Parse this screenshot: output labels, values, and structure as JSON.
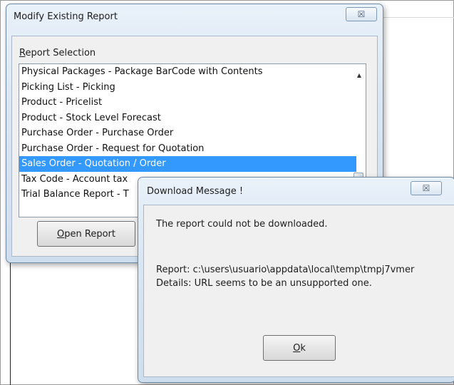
{
  "main_dialog": {
    "title": "Modify Existing Report",
    "group_label_first": "R",
    "group_label_rest": "eport Selection",
    "reports": [
      "Physical Packages - Package BarCode with Contents",
      "Picking List - Picking",
      "Product - Pricelist",
      "Product - Stock Level Forecast",
      "Purchase Order - Purchase Order",
      "Purchase Order - Request for Quotation",
      "Sales Order - Quotation / Order",
      "Tax Code - Account tax",
      "Trial Balance Report - T"
    ],
    "selected_report": "Sales Order - Quotation / Order",
    "open_button_first": "O",
    "open_button_rest": "pen Report",
    "close_glyph": "☒"
  },
  "message_dialog": {
    "title": "Download Message !",
    "message": "The report could not be downloaded.",
    "report_line": "Report: c:\\users\\usuario\\appdata\\local\\temp\\tmpj7vmer",
    "details_line": "Details: URL seems to be an unsupported one.",
    "ok_first": "O",
    "ok_rest": "k",
    "close_glyph": "☒"
  },
  "icons": {
    "scroll_up": "▲"
  },
  "colors": {
    "selection": "#3399ff",
    "dialog_face": "#f0f0f0",
    "frame_border": "#6f8aa6"
  }
}
